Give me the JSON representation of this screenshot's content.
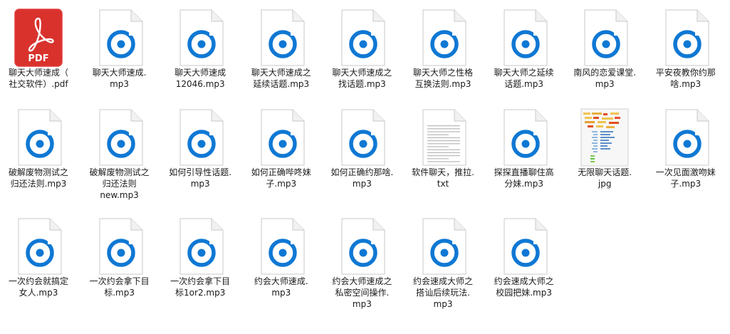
{
  "colors": {
    "audio_accent": "#0f78d4",
    "pdf_accent": "#d9322d",
    "selection_border": "#e23b3b"
  },
  "files": [
    {
      "name": "聊天大师速成（\n社交软件）.pdf",
      "type": "pdf",
      "icon": "pdf-file-icon",
      "badge": "PDF",
      "selected": true
    },
    {
      "name": "聊天大师速成.\nmp3",
      "type": "mp3",
      "icon": "audio-file-icon"
    },
    {
      "name": "聊天大师速成\n12046.mp3",
      "type": "mp3",
      "icon": "audio-file-icon"
    },
    {
      "name": "聊天大师速成之\n延续话题.mp3",
      "type": "mp3",
      "icon": "audio-file-icon"
    },
    {
      "name": "聊天大师速成之\n找话题.mp3",
      "type": "mp3",
      "icon": "audio-file-icon"
    },
    {
      "name": "聊天大师之性格\n互换法则.mp3",
      "type": "mp3",
      "icon": "audio-file-icon"
    },
    {
      "name": "聊天大师之延续\n话题.mp3",
      "type": "mp3",
      "icon": "audio-file-icon"
    },
    {
      "name": "南风的恋爱课堂.\nmp3",
      "type": "mp3",
      "icon": "audio-file-icon"
    },
    {
      "name": "平安夜教你约那\n啥.mp3",
      "type": "mp3",
      "icon": "audio-file-icon"
    },
    {
      "name": "破解废物测试之\n归还法则.mp3",
      "type": "mp3",
      "icon": "audio-file-icon"
    },
    {
      "name": "破解废物测试之\n归还法则\nnew.mp3",
      "type": "mp3",
      "icon": "audio-file-icon"
    },
    {
      "name": "如何引导性话题.\nmp3",
      "type": "mp3",
      "icon": "audio-file-icon"
    },
    {
      "name": "如何正确哔咚妹\n子.mp3",
      "type": "mp3",
      "icon": "audio-file-icon"
    },
    {
      "name": "如何正确约那啥.\nmp3",
      "type": "mp3",
      "icon": "audio-file-icon"
    },
    {
      "name": "软件聊天，推拉.\ntxt",
      "type": "txt",
      "icon": "text-file-icon"
    },
    {
      "name": "探探直播聊住高\n分妹.mp3",
      "type": "mp3",
      "icon": "audio-file-icon"
    },
    {
      "name": "无限聊天话题.\njpg",
      "type": "jpg",
      "icon": "image-thumbnail-icon"
    },
    {
      "name": "一次见面激吻妹\n子.mp3",
      "type": "mp3",
      "icon": "audio-file-icon"
    },
    {
      "name": "一次约会就搞定\n女人.mp3",
      "type": "mp3",
      "icon": "audio-file-icon"
    },
    {
      "name": "一次约会拿下目\n标.mp3",
      "type": "mp3",
      "icon": "audio-file-icon"
    },
    {
      "name": "一次约会拿下目\n标1or2.mp3",
      "type": "mp3",
      "icon": "audio-file-icon"
    },
    {
      "name": "约会大师速成.\nmp3",
      "type": "mp3",
      "icon": "audio-file-icon"
    },
    {
      "name": "约会大师速成之\n私密空间操作.\nmp3",
      "type": "mp3",
      "icon": "audio-file-icon"
    },
    {
      "name": "约会速成大师之\n搭讪后续玩法.\nmp3",
      "type": "mp3",
      "icon": "audio-file-icon"
    },
    {
      "name": "约会速成大师之\n校园把妹.mp3",
      "type": "mp3",
      "icon": "audio-file-icon"
    }
  ]
}
